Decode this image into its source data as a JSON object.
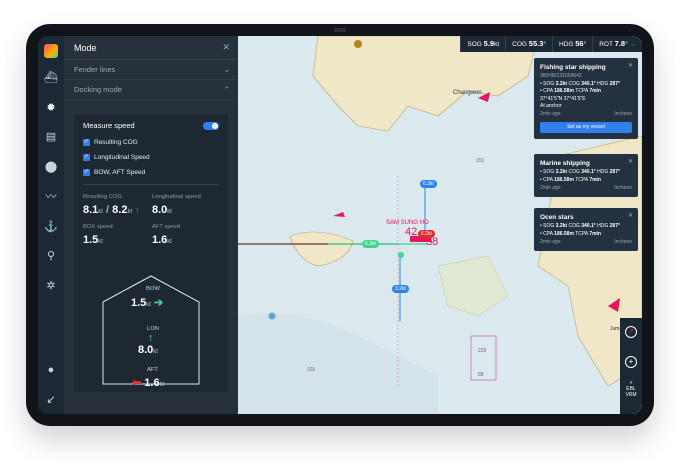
{
  "colors": {
    "accent": "#2f80ed",
    "ship_target": "#e8155f",
    "bow_arrow": "#3dd68c",
    "aft_arrow": "#e02d2d",
    "lon_arrow": "#3dd68c"
  },
  "sidebar": {
    "icons": [
      "logo-icon",
      "ship-icon",
      "gear-icon",
      "map-icon",
      "location-pin-icon",
      "route-icon",
      "anchor-icon",
      "search-icon",
      "settings-icon",
      "user-icon",
      "collapse-icon"
    ]
  },
  "panel": {
    "title": "Mode",
    "close_icon": "close-icon",
    "sections": [
      {
        "label": "Fender lines",
        "expanded": false
      },
      {
        "label": "Docking mode",
        "expanded": true
      }
    ],
    "measure_speed": {
      "label": "Measure speed",
      "on": true
    },
    "options": [
      "Resulting COG",
      "Longitudinal Speed",
      "BOW, AFT Speed"
    ],
    "resulting_cog": {
      "label": "Resulting COG",
      "value": "8.1",
      "unit": "kt",
      "slash": "/",
      "value2": "8.2",
      "unit2": "kt"
    },
    "longitudinal": {
      "label": "Longitudinal speed",
      "value": "8.0",
      "unit": "kt"
    },
    "box": {
      "label": "BOX speed",
      "value": "1.5",
      "unit": "kt"
    },
    "aft": {
      "label": "AFT speed",
      "value": "1.6",
      "unit": "kt"
    },
    "diagram": {
      "bow": {
        "label": "BOW",
        "value": "1.5",
        "unit": "kt"
      },
      "lon": {
        "label": "LON",
        "value": "8.0",
        "unit": "kt"
      },
      "aft": {
        "label": "AFT",
        "value": "1.6",
        "unit": "kt"
      }
    }
  },
  "topbar": {
    "sog": {
      "label": "SOG",
      "value": "5.9",
      "unit": "kt"
    },
    "cog": {
      "label": "COG",
      "value": "55.3",
      "unit": "°"
    },
    "hdg": {
      "label": "HDG",
      "value": "56",
      "unit": "°"
    },
    "rot": {
      "label": "ROT",
      "value": "7.8",
      "unit": "°"
    }
  },
  "cards": [
    {
      "title": "Fishing star shipping",
      "sub": "380HB/231658642",
      "sog": "3.2kt",
      "cog": "340.1°",
      "hdg": "287°",
      "cpa": "186.58m",
      "tcpa": "7min",
      "coords": "37°41'5\"N 37°41'5\"E",
      "status": "At anchor",
      "time": "2min ago",
      "port": "Incheon",
      "button": "Set as my vessel"
    },
    {
      "title": "Marine shipping",
      "sog": "3.2kt",
      "cog": "340.1°",
      "hdg": "287°",
      "cpa": "186.58m",
      "tcpa": "7min",
      "time": "2min ago",
      "port": "Incheon"
    },
    {
      "title": "Ocen stars",
      "sog": "3.2kt",
      "cog": "340.1°",
      "hdg": "287°",
      "cpa": "186.58m",
      "tcpa": "7min",
      "time": "2min ago",
      "port": "Incheon"
    }
  ],
  "map": {
    "place": "Changwon",
    "place2": "Jumanote",
    "target_name": "SAM SUNG HO",
    "target_nums": [
      "42",
      "38"
    ],
    "speed_tags": [
      "6.2kt",
      "6.2kt",
      "3.2kt",
      "6.2kt"
    ],
    "depths": [
      "151",
      "101",
      "229",
      "88"
    ]
  },
  "rtools": {
    "ebl": "EBL",
    "vrm": "VRM"
  }
}
